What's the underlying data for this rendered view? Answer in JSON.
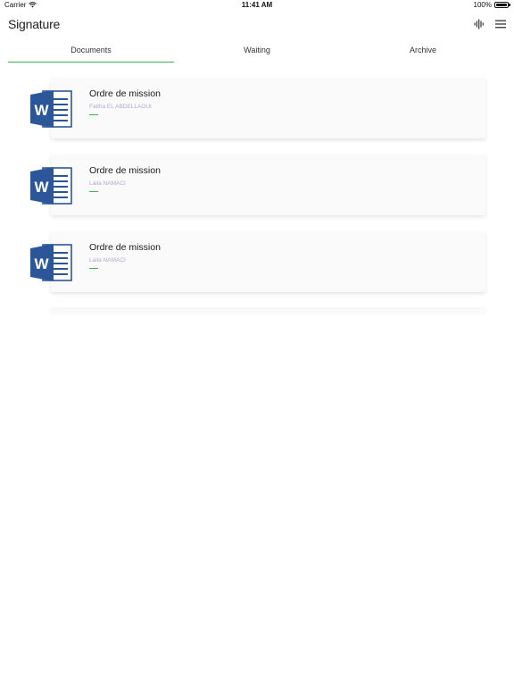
{
  "status_bar": {
    "carrier": "Carrier",
    "time": "11:41 AM",
    "battery": "100%"
  },
  "header": {
    "title": "Signature",
    "icons": [
      "voice-wave-icon",
      "hamburger-menu-icon"
    ]
  },
  "tabs": [
    {
      "label": "Documents",
      "active": true
    },
    {
      "label": "Waiting",
      "active": false
    },
    {
      "label": "Archive",
      "active": false
    }
  ],
  "documents": [
    {
      "title": "Ordre de mission",
      "author": "Fatiha EL ABDELLAOUI",
      "icon": "word-doc-icon"
    },
    {
      "title": "Ordre de mission",
      "author": "Laila NAMACI",
      "icon": "word-doc-icon"
    },
    {
      "title": "Ordre de mission",
      "author": "Laila NAMACI",
      "icon": "word-doc-icon"
    }
  ],
  "colors": {
    "accent_green": "#3ab54a",
    "word_blue": "#2b579a",
    "subtitle_purple": "#b2a6d6"
  }
}
